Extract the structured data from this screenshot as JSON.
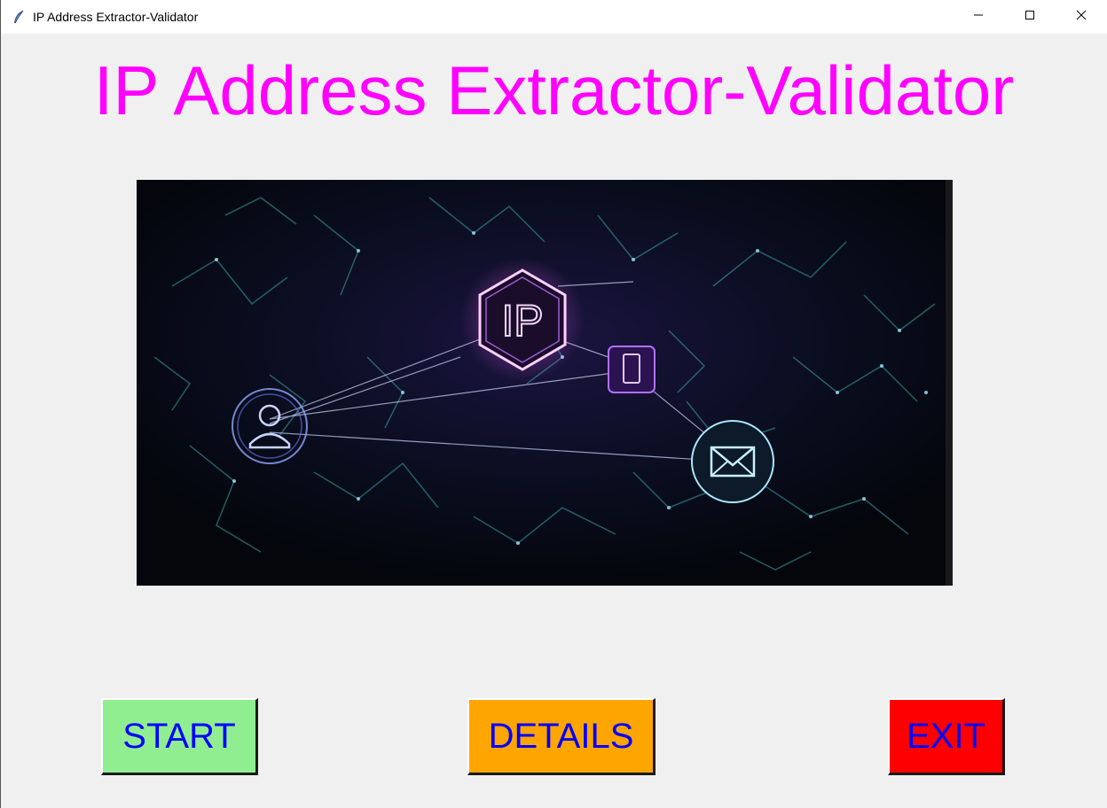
{
  "window": {
    "title": "IP Address Extractor-Validator",
    "controls": [
      "minimize-icon",
      "maximize-icon",
      "close-icon"
    ]
  },
  "main": {
    "heading": "IP Address Extractor-Validator",
    "heading_color": "#ff00ff",
    "banner": {
      "label": "IP",
      "icons": [
        "user-icon",
        "ip-hexagon-icon",
        "mobile-icon",
        "mail-icon"
      ]
    }
  },
  "buttons": {
    "start_label": "START",
    "details_label": "DETAILS",
    "exit_label": "EXIT",
    "start_color": "#90ee90",
    "details_color": "#ffa500",
    "exit_color": "#ff0000",
    "text_color": "#0000ff"
  }
}
